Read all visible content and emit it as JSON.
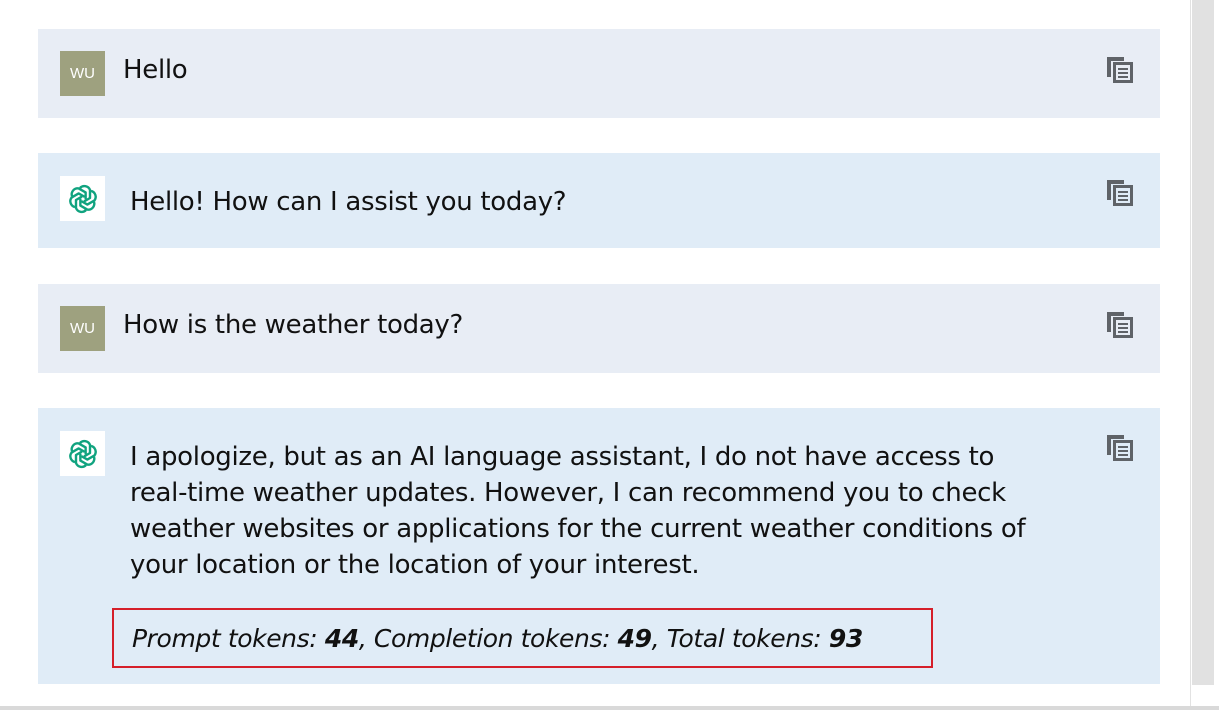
{
  "messages": [
    {
      "role": "user",
      "avatar_text": "WU",
      "text": "Hello"
    },
    {
      "role": "assistant",
      "text": "Hello! How can I assist you today?"
    },
    {
      "role": "user",
      "avatar_text": "WU",
      "text": "How is the weather today?"
    },
    {
      "role": "assistant",
      "lines": [
        "I apologize, but as an AI language assistant, I do not have access to",
        "real-time weather updates. However, I can recommend you to check",
        "weather websites or applications for the current weather conditions of",
        "your location or the location of your interest."
      ]
    }
  ],
  "tokens": {
    "prompt_label": "Prompt tokens: ",
    "prompt_value": "44",
    "sep1": ", ",
    "completion_label": "Completion tokens: ",
    "completion_value": "49",
    "sep2": ", ",
    "total_label": "Total tokens: ",
    "total_value": "93"
  },
  "icons": {
    "copy": "copy-icon",
    "assistant_avatar": "openai-logo-icon"
  },
  "colors": {
    "user_bg": "#e8edf5",
    "assistant_bg": "#e0ecf7",
    "user_avatar": "#9ea17f",
    "logo_green": "#10a37f",
    "highlight_border": "#d51f2a"
  }
}
